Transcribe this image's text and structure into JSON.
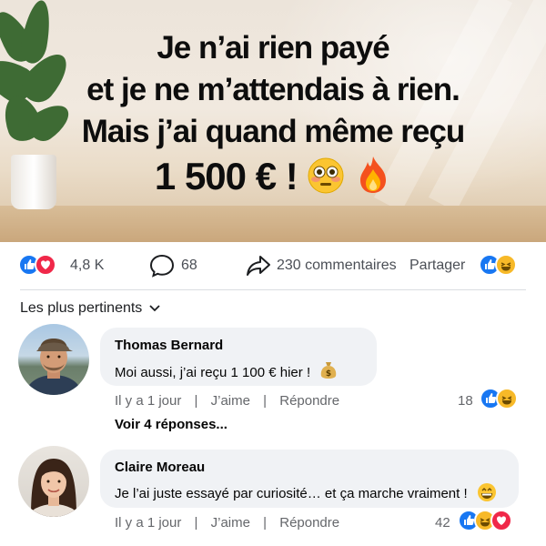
{
  "hero": {
    "line1": "Je n’ai rien payé",
    "line2": "et je ne m’attendais à rien.",
    "line3": "Mais j’ai quand même reçu",
    "line4": "1 500 € !"
  },
  "stats": {
    "reactions_count": "4,8 K",
    "comments_count": "68",
    "shares_text": "230 commentaires",
    "share_label": "Partager"
  },
  "sort": {
    "label": "Les plus pertinents"
  },
  "comments": [
    {
      "author": "Thomas Bernard",
      "text": "Moi aussi, j’ai reçu 1 100 € hier !",
      "time": "Il y a 1 jour",
      "like_label": "J’aime",
      "reply_label": "Répondre",
      "reaction_count": "18",
      "more_replies": "Voir 4 réponses..."
    },
    {
      "author": "Claire Moreau",
      "text": "Je l’ai juste essayé par curiosité… et ça marche vraiment !",
      "time": "Il y a 1 jour",
      "like_label": "J’aime",
      "reply_label": "Répondre",
      "reaction_count": "42"
    }
  ],
  "separator": "|",
  "icons": {
    "like": "like-reaction-icon",
    "love": "love-reaction-icon",
    "haha": "haha-reaction-icon",
    "comment": "comment-bubble-icon",
    "share": "share-arrow-icon",
    "chevron": "chevron-down-icon",
    "money_bag": "money-bag-emoji",
    "grin": "grinning-emoji",
    "flushed": "flushed-face-emoji",
    "fire": "fire-emoji"
  },
  "colors": {
    "like_blue": "#1877f2",
    "love_red": "#f02849",
    "haha_yellow": "#f7b928",
    "bubble_bg": "#f0f2f5",
    "meta_gray": "#65676b"
  }
}
